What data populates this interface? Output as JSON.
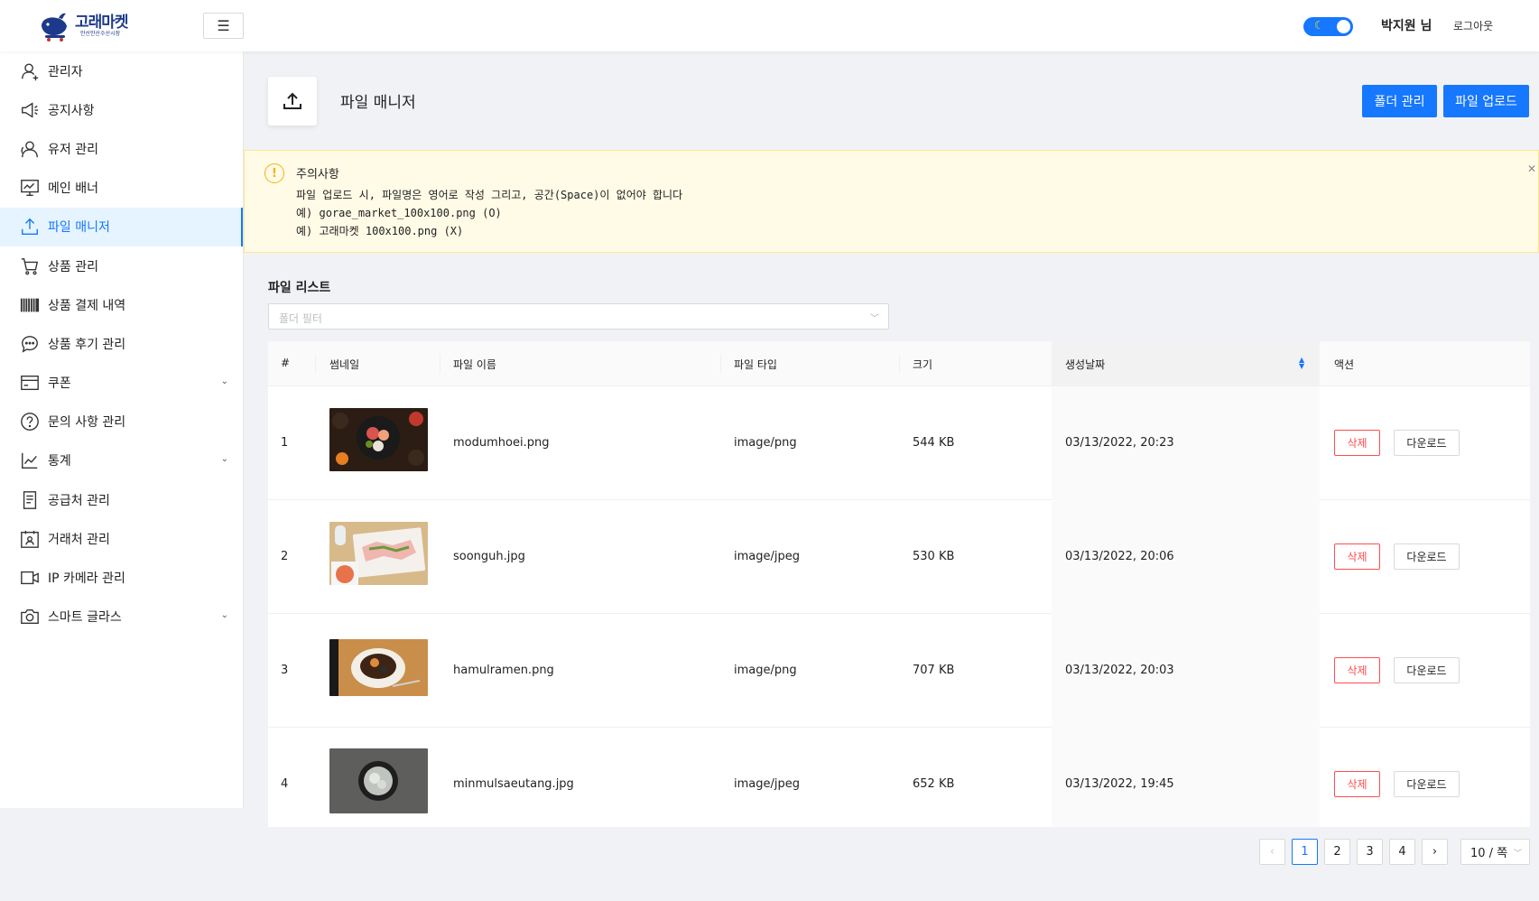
{
  "brand": {
    "name": "고래마켓",
    "tagline": "안산안산수산시장"
  },
  "header": {
    "user_name": "박지원 님",
    "logout_label": "로그아웃",
    "theme_toggle_icon": "moon-icon"
  },
  "sidebar": {
    "items": [
      {
        "label": "관리자",
        "icon": "admin-user-icon"
      },
      {
        "label": "공지사항",
        "icon": "megaphone-icon"
      },
      {
        "label": "유저 관리",
        "icon": "users-icon"
      },
      {
        "label": "메인 배너",
        "icon": "monitor-chart-icon"
      },
      {
        "label": "파일 매니저",
        "icon": "upload-icon",
        "active": true
      },
      {
        "label": "상품 관리",
        "icon": "cart-icon"
      },
      {
        "label": "상품 결제 내역",
        "icon": "barcode-icon"
      },
      {
        "label": "상품 후기 관리",
        "icon": "chat-icon"
      },
      {
        "label": "쿠폰",
        "icon": "card-icon",
        "expandable": true
      },
      {
        "label": "문의 사항 관리",
        "icon": "question-icon"
      },
      {
        "label": "통계",
        "icon": "line-chart-icon",
        "expandable": true
      },
      {
        "label": "공급처 관리",
        "icon": "document-icon"
      },
      {
        "label": "거래처 관리",
        "icon": "contact-card-icon"
      },
      {
        "label": "IP 카메라 관리",
        "icon": "video-camera-icon"
      },
      {
        "label": "스마트 글라스",
        "icon": "camera-icon",
        "expandable": true
      }
    ]
  },
  "page": {
    "title": "파일 매니저",
    "folder_button": "폴더 관리",
    "upload_button": "파일 업로드"
  },
  "notice": {
    "title": "주의사항",
    "lines": [
      "파일 업로드 시, 파일명은 영어로 작성 그리고, 공간(Space)이 없어야 합니다",
      "예) gorae_market_100x100.png (O)",
      "예) 고래마켓 100x100.png (X)"
    ]
  },
  "file_list": {
    "title": "파일 리스트",
    "filter_placeholder": "폴더 필터",
    "columns": [
      "#",
      "썸네일",
      "파일 이름",
      "파일 타입",
      "크기",
      "생성날짜",
      "액션"
    ],
    "rows": [
      {
        "index": "1",
        "name": "modumhoei.png",
        "type": "image/png",
        "size": "544 KB",
        "created": "03/13/2022, 20:23"
      },
      {
        "index": "2",
        "name": "soonguh.jpg",
        "type": "image/jpeg",
        "size": "530 KB",
        "created": "03/13/2022, 20:06"
      },
      {
        "index": "3",
        "name": "hamulramen.png",
        "type": "image/png",
        "size": "707 KB",
        "created": "03/13/2022, 20:03"
      },
      {
        "index": "4",
        "name": "minmulsaeutang.jpg",
        "type": "image/jpeg",
        "size": "652 KB",
        "created": "03/13/2022, 19:45"
      }
    ],
    "delete_label": "삭제",
    "download_label": "다운로드"
  },
  "pagination": {
    "pages": [
      "1",
      "2",
      "3",
      "4"
    ],
    "current": "1",
    "page_size": "10 / 쪽"
  },
  "colors": {
    "primary": "#1677ff",
    "danger": "#ff4d4f",
    "warning": "#faad14",
    "alert_bg": "#fffbe6"
  }
}
